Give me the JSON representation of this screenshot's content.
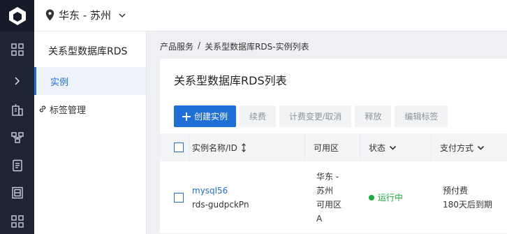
{
  "region": {
    "label": "华东 - 苏州"
  },
  "sidebar": {
    "title": "关系型数据库RDS",
    "items": [
      {
        "label": "实例"
      },
      {
        "label": "标签管理"
      }
    ]
  },
  "breadcrumb": {
    "root": "产品服务",
    "separator": "/",
    "current": "关系型数据库RDS-实例列表"
  },
  "page": {
    "title": "关系型数据库RDS列表"
  },
  "toolbar": {
    "create": "创建实例",
    "renew": "续费",
    "billing": "计费变更/取消",
    "release": "释放",
    "edit_tags": "编辑标签"
  },
  "table": {
    "headers": {
      "name": "实例名称/ID",
      "zone": "可用区",
      "status": "状态",
      "payment": "支付方式"
    },
    "rows": [
      {
        "name": "mysql56",
        "id": "rds-gudpckPn",
        "zone_lines": [
          "华东 -",
          "苏州",
          "可用区",
          "A"
        ],
        "status": "运行中",
        "payment_lines": [
          "预付费",
          "180天后到期"
        ]
      }
    ]
  },
  "colors": {
    "accent": "#1f6fd9",
    "rail": "#1e2435",
    "success": "#1aad3c"
  }
}
